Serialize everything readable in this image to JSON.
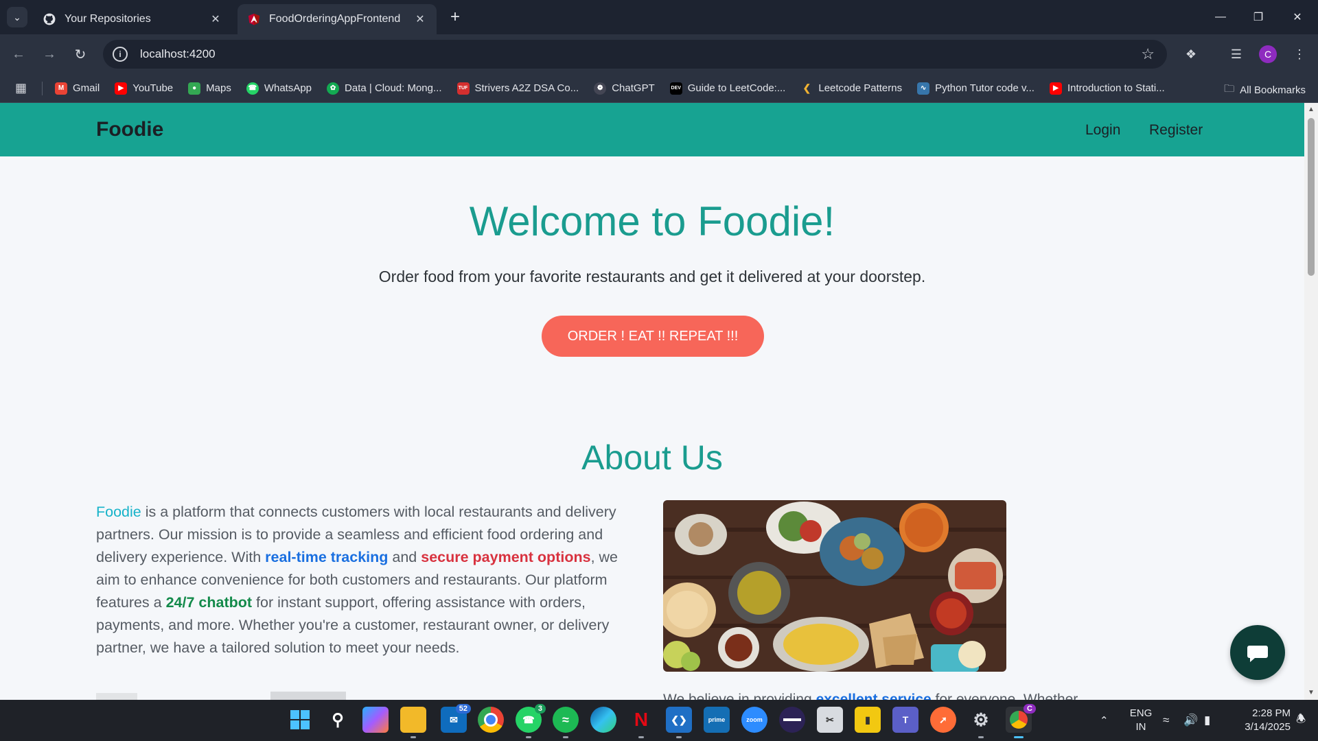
{
  "browser": {
    "tabs": [
      {
        "title": "Your Repositories",
        "active": false
      },
      {
        "title": "FoodOrderingAppFrontend",
        "active": true
      }
    ],
    "address": "localhost:4200",
    "bookmarks": [
      {
        "label": "Gmail",
        "color": "#ea4335"
      },
      {
        "label": "YouTube",
        "color": "#ff0000"
      },
      {
        "label": "Maps",
        "color": "#34a853"
      },
      {
        "label": "WhatsApp",
        "color": "#25d366"
      },
      {
        "label": "Data | Cloud: Mong...",
        "color": "#13aa52"
      },
      {
        "label": "Strivers A2Z DSA Co...",
        "color": "#d42f2f"
      },
      {
        "label": "ChatGPT",
        "color": "#444654"
      },
      {
        "label": "Guide to LeetCode:...",
        "color": "#000000"
      },
      {
        "label": "Leetcode Patterns",
        "color": "#f0b232"
      },
      {
        "label": "Python Tutor code v...",
        "color": "#3776ab"
      },
      {
        "label": "Introduction to Stati...",
        "color": "#ff0000"
      }
    ],
    "all_bookmarks": "All Bookmarks",
    "profile_initial": "C"
  },
  "page": {
    "brand": "Foodie",
    "nav": {
      "login": "Login",
      "register": "Register"
    },
    "hero": {
      "title": "Welcome to Foodie!",
      "subtitle": "Order food from your favorite restaurants and get it delivered at your doorstep.",
      "cta": "ORDER ! EAT !! REPEAT !!!"
    },
    "about": {
      "title": "About Us",
      "p_brand": "Foodie",
      "p1": " is a platform that connects customers with local restaurants and delivery partners. Our mission is to provide a seamless and efficient food ordering and delivery experience. With ",
      "h1": "real-time tracking",
      "p2": " and ",
      "h2": "secure payment options",
      "p3": ", we aim to enhance convenience for both customers and restaurants. Our platform features a ",
      "h3": "24/7 chatbot",
      "p4": " for instant support, offering assistance with orders, payments, and more. Whether you're a customer, restaurant owner, or delivery partner, we have a tailored solution to meet your needs.",
      "partial_a": "We believe in providing ",
      "partial_b": "excellent service",
      "partial_c": " for everyone. Whether"
    },
    "colors": {
      "navbar": "#17a392",
      "accent": "#1a9c8f",
      "cta": "#f76659",
      "chat": "#0e3d37"
    }
  },
  "taskbar": {
    "badges": {
      "outlook": "52",
      "whatsapp": "3"
    },
    "lang_top": "ENG",
    "lang_bottom": "IN",
    "time": "2:28 PM",
    "date": "3/14/2025",
    "profile_initial": "C"
  }
}
